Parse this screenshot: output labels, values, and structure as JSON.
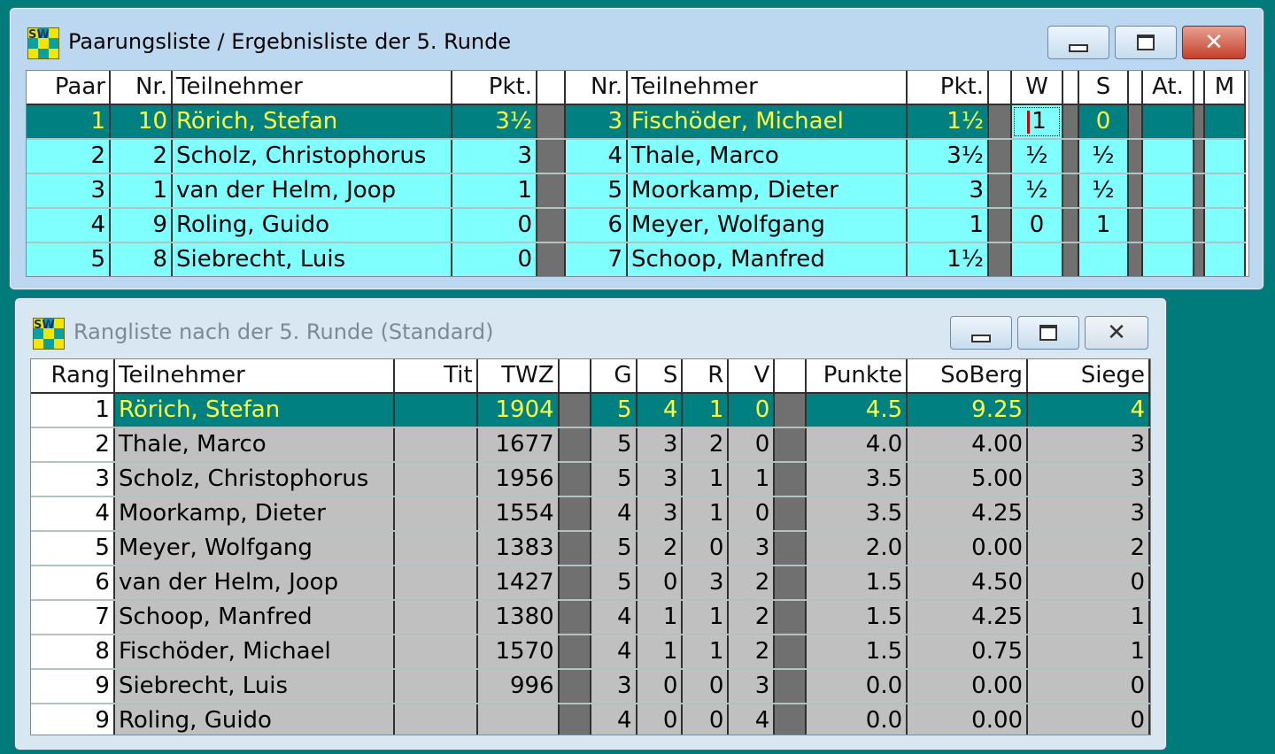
{
  "pairing_window": {
    "title": "Paarungsliste / Ergebnisliste der 5. Runde",
    "icon": "sw-app-icon",
    "icon_text": "SW",
    "headers": {
      "paar": "Paar",
      "nr1": "Nr.",
      "name1": "Teilnehmer",
      "pkt1": "Pkt.",
      "nr2": "Nr.",
      "name2": "Teilnehmer",
      "pkt2": "Pkt.",
      "w": "W",
      "s": "S",
      "at": "At.",
      "m": "M"
    },
    "rows": [
      {
        "paar": "1",
        "nr1": "10",
        "name1": "Rörich, Stefan",
        "pkt1": "3½",
        "nr2": "3",
        "name2": "Fischöder, Michael",
        "pkt2": "1½",
        "w": "1",
        "s": "0"
      },
      {
        "paar": "2",
        "nr1": "2",
        "name1": "Scholz, Christophorus",
        "pkt1": "3",
        "nr2": "4",
        "name2": "Thale, Marco",
        "pkt2": "3½",
        "w": "½",
        "s": "½"
      },
      {
        "paar": "3",
        "nr1": "1",
        "name1": "van der Helm, Joop",
        "pkt1": "1",
        "nr2": "5",
        "name2": "Moorkamp, Dieter",
        "pkt2": "3",
        "w": "½",
        "s": "½"
      },
      {
        "paar": "4",
        "nr1": "9",
        "name1": "Roling, Guido",
        "pkt1": "0",
        "nr2": "6",
        "name2": "Meyer, Wolfgang",
        "pkt2": "1",
        "w": "0",
        "s": "1"
      },
      {
        "paar": "5",
        "nr1": "8",
        "name1": "Siebrecht, Luis",
        "pkt1": "0",
        "nr2": "7",
        "name2": "Schoop, Manfred",
        "pkt2": "1½",
        "w": "",
        "s": ""
      }
    ]
  },
  "ranking_window": {
    "title": "Rangliste nach der 5. Runde (Standard)",
    "icon": "sw-app-icon",
    "icon_text": "SW",
    "headers": {
      "rang": "Rang",
      "name": "Teilnehmer",
      "tit": "Tit",
      "twz": "TWZ",
      "g": "G",
      "s": "S",
      "r": "R",
      "v": "V",
      "punkte": "Punkte",
      "soberg": "SoBerg",
      "siege": "Siege"
    },
    "rows": [
      {
        "rang": "1",
        "name": "Rörich, Stefan",
        "tit": "",
        "twz": "1904",
        "g": "5",
        "s": "4",
        "r": "1",
        "v": "0",
        "punkte": "4.5",
        "soberg": "9.25",
        "siege": "4"
      },
      {
        "rang": "2",
        "name": "Thale, Marco",
        "tit": "",
        "twz": "1677",
        "g": "5",
        "s": "3",
        "r": "2",
        "v": "0",
        "punkte": "4.0",
        "soberg": "4.00",
        "siege": "3"
      },
      {
        "rang": "3",
        "name": "Scholz, Christophorus",
        "tit": "",
        "twz": "1956",
        "g": "5",
        "s": "3",
        "r": "1",
        "v": "1",
        "punkte": "3.5",
        "soberg": "5.00",
        "siege": "3"
      },
      {
        "rang": "4",
        "name": "Moorkamp, Dieter",
        "tit": "",
        "twz": "1554",
        "g": "4",
        "s": "3",
        "r": "1",
        "v": "0",
        "punkte": "3.5",
        "soberg": "4.25",
        "siege": "3"
      },
      {
        "rang": "5",
        "name": "Meyer, Wolfgang",
        "tit": "",
        "twz": "1383",
        "g": "5",
        "s": "2",
        "r": "0",
        "v": "3",
        "punkte": "2.0",
        "soberg": "0.00",
        "siege": "2"
      },
      {
        "rang": "6",
        "name": "van der Helm, Joop",
        "tit": "",
        "twz": "1427",
        "g": "5",
        "s": "0",
        "r": "3",
        "v": "2",
        "punkte": "1.5",
        "soberg": "4.50",
        "siege": "0"
      },
      {
        "rang": "7",
        "name": "Schoop, Manfred",
        "tit": "",
        "twz": "1380",
        "g": "4",
        "s": "1",
        "r": "1",
        "v": "2",
        "punkte": "1.5",
        "soberg": "4.25",
        "siege": "1"
      },
      {
        "rang": "8",
        "name": "Fischöder, Michael",
        "tit": "",
        "twz": "1570",
        "g": "4",
        "s": "1",
        "r": "1",
        "v": "2",
        "punkte": "1.5",
        "soberg": "0.75",
        "siege": "1"
      },
      {
        "rang": "9",
        "name": "Siebrecht, Luis",
        "tit": "",
        "twz": "996",
        "g": "3",
        "s": "0",
        "r": "0",
        "v": "3",
        "punkte": "0.0",
        "soberg": "0.00",
        "siege": "0"
      },
      {
        "rang": "9",
        "name": "Roling, Guido",
        "tit": "",
        "twz": "",
        "g": "4",
        "s": "0",
        "r": "0",
        "v": "4",
        "punkte": "0.0",
        "soberg": "0.00",
        "siege": "0"
      }
    ]
  },
  "colors": {
    "desktop": "#007b7b",
    "row_cyan": "#80ffff",
    "selected_row": "#008080",
    "selected_text": "#ffff40",
    "row_gray": "#c0c0c0"
  }
}
